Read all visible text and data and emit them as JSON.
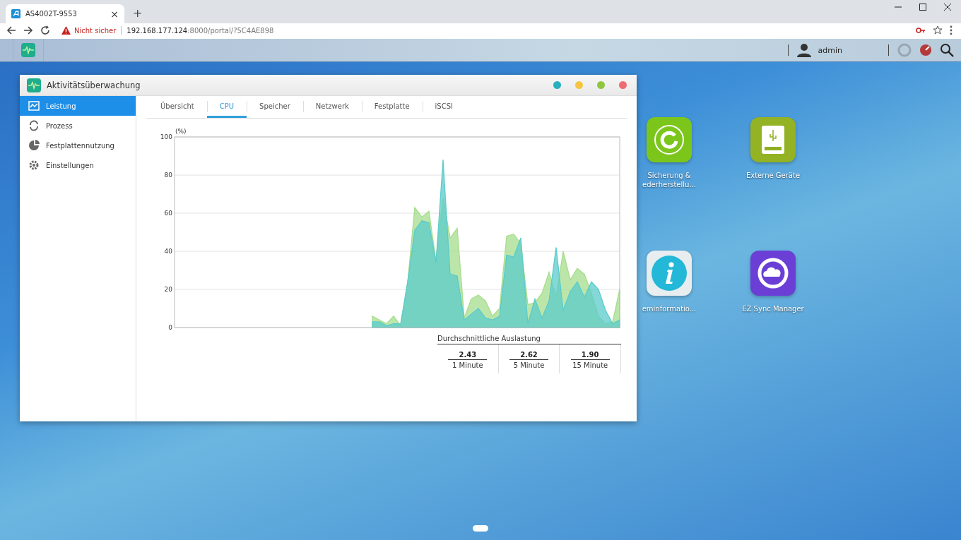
{
  "browser": {
    "tab": {
      "title": "AS4002T-9553",
      "close": "×"
    },
    "new_tab": "+",
    "security": "Nicht sicher",
    "url": {
      "host": "192.168.177.124",
      "rest": ":8000/portal/?5C4AE898"
    }
  },
  "topbar": {
    "user": "admin"
  },
  "window": {
    "title": "Aktivitätsüberwachung",
    "sidebar": [
      {
        "label": "Leistung",
        "selected": true
      },
      {
        "label": "Prozess",
        "selected": false
      },
      {
        "label": "Festplattennutzung",
        "selected": false
      },
      {
        "label": "Einstellungen",
        "selected": false
      }
    ],
    "tabs": [
      {
        "label": "Übersicht",
        "selected": false
      },
      {
        "label": "CPU",
        "selected": true
      },
      {
        "label": "Speicher",
        "selected": false
      },
      {
        "label": "Netzwerk",
        "selected": false
      },
      {
        "label": "Festplatte",
        "selected": false
      },
      {
        "label": "iSCSI",
        "selected": false
      }
    ],
    "chart_data": {
      "type": "area",
      "ylabel": "(%)",
      "ylim": [
        0,
        100
      ],
      "yticks": [
        0,
        20,
        40,
        60,
        80,
        100
      ],
      "grid": true,
      "series": [
        {
          "color": "#a6dd8c",
          "values": [
            null,
            null,
            null,
            null,
            null,
            null,
            null,
            null,
            null,
            null,
            null,
            null,
            null,
            null,
            null,
            null,
            null,
            null,
            null,
            null,
            null,
            null,
            null,
            null,
            null,
            null,
            null,
            null,
            6,
            4,
            2,
            6,
            1,
            24,
            63,
            58,
            61,
            35,
            68,
            47,
            52,
            5,
            15,
            17,
            14,
            6,
            10,
            48,
            49,
            44,
            12,
            13,
            18,
            29,
            16,
            40,
            25,
            31,
            28,
            18,
            6,
            2,
            3,
            20
          ]
        },
        {
          "color": "#5ccbcb",
          "values": [
            null,
            null,
            null,
            null,
            null,
            null,
            null,
            null,
            null,
            null,
            null,
            null,
            null,
            null,
            null,
            null,
            null,
            null,
            null,
            null,
            null,
            null,
            null,
            null,
            null,
            null,
            null,
            null,
            3,
            3,
            1,
            2,
            2,
            24,
            51,
            56,
            55,
            34,
            88,
            28,
            27,
            4,
            7,
            10,
            5,
            4,
            6,
            38,
            37,
            47,
            2,
            15,
            5,
            14,
            42,
            9,
            19,
            24,
            16,
            24,
            20,
            9,
            2,
            4
          ]
        }
      ]
    },
    "load": {
      "title": "Durchschnittliche Auslastung",
      "items": [
        {
          "value": "2.43",
          "label": "1 Minute"
        },
        {
          "value": "2.62",
          "label": "5 Minute"
        },
        {
          "value": "1.90",
          "label": "15 Minute"
        }
      ]
    }
  },
  "desktop_apps": [
    {
      "lines": [
        "Sicherung &",
        "ederherstellu..."
      ]
    },
    {
      "lines": [
        "Externe Geräte"
      ]
    },
    {
      "lines": [
        "eminformatio..."
      ]
    },
    {
      "lines": [
        "EZ Sync Manager"
      ]
    }
  ]
}
